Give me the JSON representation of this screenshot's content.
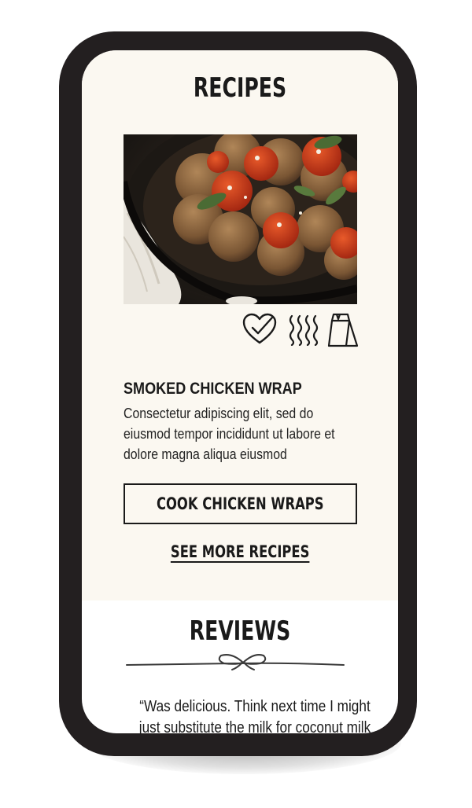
{
  "recipes": {
    "title": "RECIPES",
    "photo_alt": "meatballs with roasted tomatoes in a skillet",
    "icons": [
      "heart-check-icon",
      "steam-icon",
      "paper-bag-icon"
    ],
    "recipe_name": "SMOKED CHICKEN WRAP",
    "description": "Consectetur adipiscing elit, sed do eiusmod tempor incididunt ut labore et dolore magna aliqua eiusmod",
    "cta_label": "COOK CHICKEN WRAPS",
    "more_link": "SEE MORE RECIPES"
  },
  "reviews": {
    "title": "REVIEWS",
    "quote": "“Was delicious. Think next time I might just substitute the milk for coconut milk"
  },
  "colors": {
    "phone_frame": "#231f20",
    "recipes_bg": "#fbf8f1",
    "text": "#1a1a1a"
  }
}
